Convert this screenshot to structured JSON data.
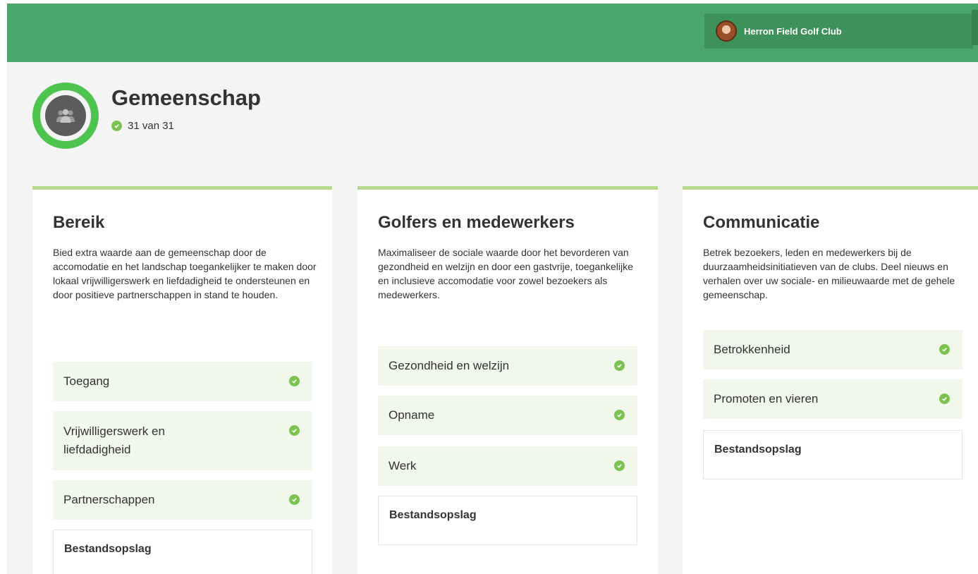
{
  "header": {
    "club_name": "Herron Field Golf Club",
    "colors": {
      "bar": "#4aa66b",
      "club_panel": "#3e915b"
    }
  },
  "page": {
    "title": "Gemeenschap",
    "progress_text": "31 van 31",
    "icon": "users-icon",
    "ring_color": "#4cc44e"
  },
  "cards": [
    {
      "title": "Bereik",
      "description": "Bied extra waarde aan de gemeenschap door de accomodatie en het landschap toegankelijker te maken door lokaal vrijwilligerswerk en liefdadigheid te ondersteunen en door positieve partnerschappen in stand te houden.",
      "items": [
        {
          "label": "Toegang",
          "complete": true
        },
        {
          "label": "Vrijwilligerswerk en liefdadigheid",
          "complete": true
        },
        {
          "label": "Partnerschappen",
          "complete": true
        }
      ],
      "storage_label": "Bestandsopslag"
    },
    {
      "title": "Golfers en medewerkers",
      "description": "Maximaliseer de sociale waarde door het bevorderen van gezondheid en welzijn en door een gastvrije, toegankelijke en inclusieve accomodatie voor zowel bezoekers als medewerkers.",
      "items": [
        {
          "label": "Gezondheid en welzijn",
          "complete": true
        },
        {
          "label": "Opname",
          "complete": true
        },
        {
          "label": "Werk",
          "complete": true
        }
      ],
      "storage_label": "Bestandsopslag"
    },
    {
      "title": "Communicatie",
      "description": "Betrek bezoekers, leden en medewerkers bij de duurzaamheidsinitiatieven van de clubs. Deel nieuws en verhalen over uw sociale- en milieuwaarde met de gehele gemeenschap.",
      "items": [
        {
          "label": "Betrokkenheid",
          "complete": true
        },
        {
          "label": "Promoten en vieren",
          "complete": true
        }
      ],
      "storage_label": "Bestandsopslag"
    }
  ],
  "colors": {
    "check": "#7cc251",
    "card_accent": "#b6d98e",
    "item_bg": "#f1f7ea"
  }
}
